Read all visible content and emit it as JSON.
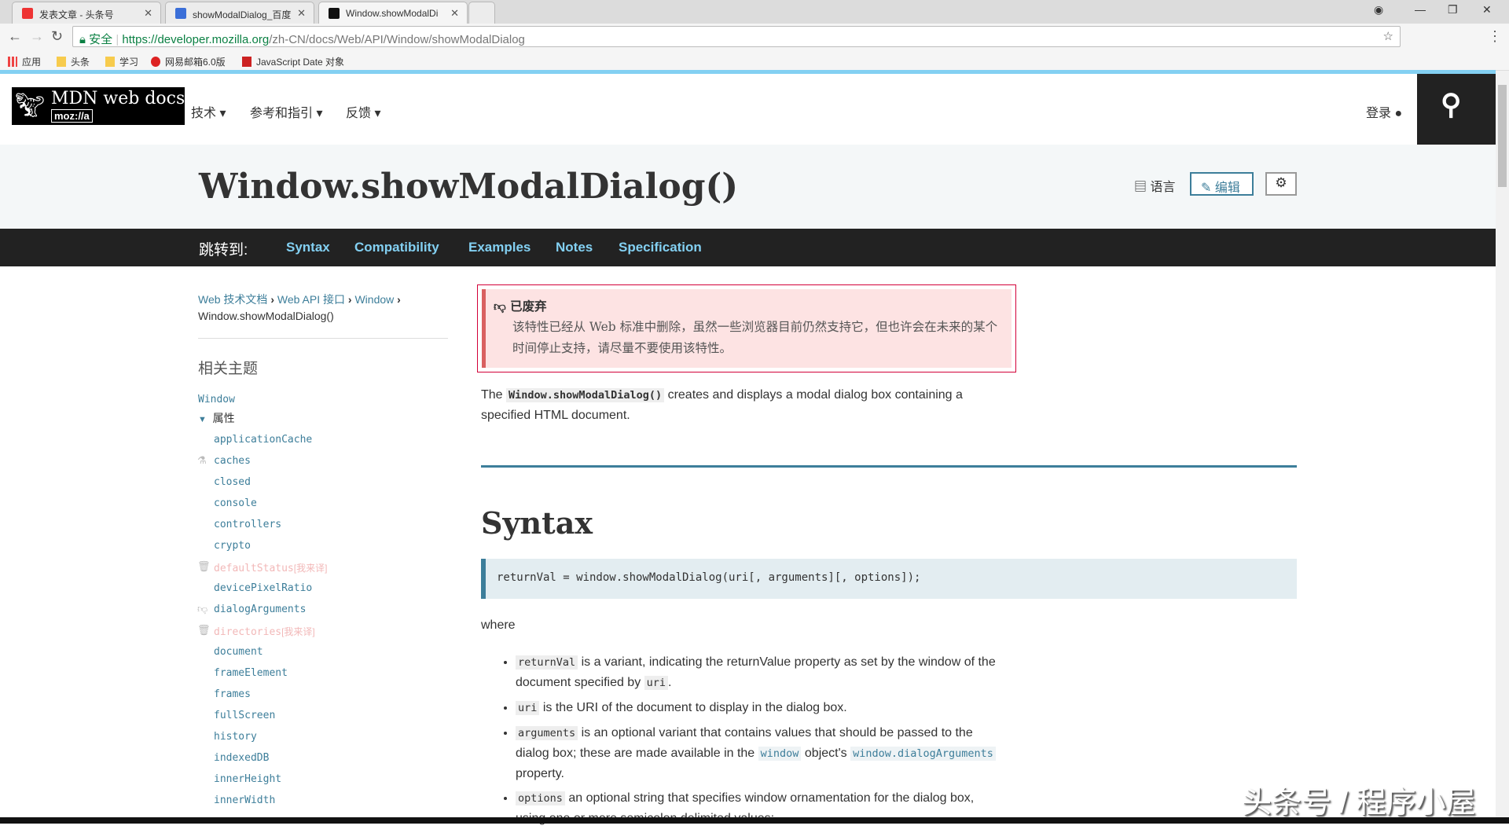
{
  "browser": {
    "tabs": [
      {
        "title": "发表文章 - 头条号"
      },
      {
        "title": "showModalDialog_百度"
      },
      {
        "title": "Window.showModalDi"
      }
    ],
    "secure_label": "安全",
    "url_host": "https://developer.mozilla.org",
    "url_path": "/zh-CN/docs/Web/API/Window/showModalDialog",
    "bookmarks": [
      "应用",
      "头条",
      "学习",
      "网易邮箱6.0版",
      "JavaScript Date 对象"
    ]
  },
  "header": {
    "logo_text": "MDN web docs",
    "logo_sub": "moz://a",
    "nav": [
      "技术",
      "参考和指引",
      "反馈"
    ],
    "login": "登录"
  },
  "page": {
    "title": "Window.showModalDialog()",
    "language": "语言",
    "edit": "编辑"
  },
  "jump": {
    "label": "跳转到:",
    "links": [
      "Syntax",
      "Compatibility",
      "Examples",
      "Notes",
      "Specification"
    ]
  },
  "sidebar": {
    "breadcrumb": [
      "Web 技术文档",
      "Web API 接口",
      "Window"
    ],
    "breadcrumb_current": "Window.showModalDialog()",
    "related": "相关主题",
    "root": "Window",
    "group": "属性",
    "items": [
      {
        "label": "applicationCache"
      },
      {
        "label": "caches",
        "icon": "flask-icon"
      },
      {
        "label": "closed"
      },
      {
        "label": "console"
      },
      {
        "label": "controllers"
      },
      {
        "label": "crypto"
      },
      {
        "label": "defaultStatus",
        "icon": "trash-icon",
        "deprecated": true,
        "tag": "[我来译]"
      },
      {
        "label": "devicePixelRatio"
      },
      {
        "label": "dialogArguments",
        "icon": "thumbs-down-icon"
      },
      {
        "label": "directories",
        "icon": "trash-icon",
        "deprecated": true,
        "tag": "[我来译]"
      },
      {
        "label": "document"
      },
      {
        "label": "frameElement"
      },
      {
        "label": "frames"
      },
      {
        "label": "fullScreen"
      },
      {
        "label": "history"
      },
      {
        "label": "indexedDB"
      },
      {
        "label": "innerHeight"
      },
      {
        "label": "innerWidth"
      }
    ]
  },
  "notice": {
    "title": "已废弃",
    "text": "该特性已经从 Web 标准中删除，虽然一些浏览器目前仍然支持它，但也许会在未来的某个时间停止支持，请尽量不要使用该特性。"
  },
  "content": {
    "intro_pre": "The",
    "intro_code": "Window.showModalDialog()",
    "intro_post": "creates and displays a modal dialog box containing a specified HTML document.",
    "syntax_heading": "Syntax",
    "syntax_code": "returnVal = window.showModalDialog(uri[, arguments][, options]);",
    "where": "where",
    "bullets": [
      {
        "code": "returnVal",
        "text": "is a variant, indicating the returnValue property as set by the window of the document specified by",
        "code2": "uri",
        "end": "."
      },
      {
        "code": "uri",
        "text": "is the URI of the document to display in the dialog box."
      },
      {
        "code": "arguments",
        "text": "is an optional variant that contains values that should be passed to the dialog box; these are made available in the",
        "code2": "window",
        "mid": "object's",
        "code3": "window.dialogArguments",
        "end": "property."
      },
      {
        "code": "options",
        "text": "an optional string that specifies window ornamentation for the dialog box, using one or more semicolon delimited values:"
      }
    ]
  },
  "watermark": "头条号 / 程序小屋",
  "colors": {
    "accent": "#83d0f2",
    "link": "#3d7e9a",
    "deprecated_border": "#d30038",
    "notice_bg": "#fde3e3"
  }
}
